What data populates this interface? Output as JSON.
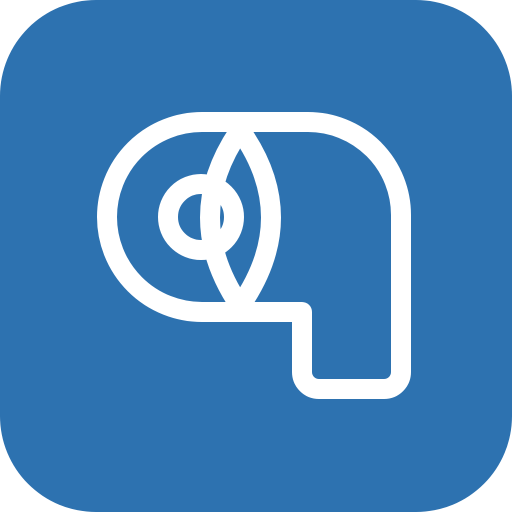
{
  "app_icon": {
    "name": "toilet-paper-roll-icon",
    "colors": {
      "background": "#2d72b0",
      "glyph_stroke": "#ffffff"
    }
  }
}
